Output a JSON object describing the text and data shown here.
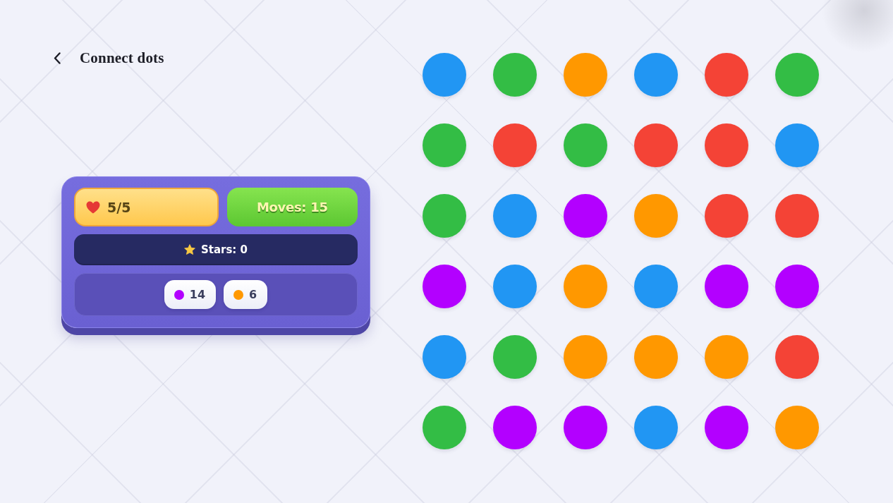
{
  "header": {
    "title": "Connect dots"
  },
  "stats": {
    "lives": "5/5",
    "moves": "Moves: 15",
    "stars": "Stars: 0",
    "goals": [
      {
        "color": "#b300ff",
        "count": "14"
      },
      {
        "color": "#ff9800",
        "count": "6"
      }
    ]
  },
  "board": {
    "rows": [
      [
        {
          "color": "#2196f3"
        },
        {
          "color": "#33bd45"
        },
        {
          "color": "#ff9800"
        },
        {
          "color": "#2196f3"
        },
        {
          "color": "#f44336"
        },
        {
          "color": "#33bd45"
        }
      ],
      [
        {
          "color": "#33bd45"
        },
        {
          "color": "#f44336"
        },
        {
          "color": "#33bd45"
        },
        {
          "color": "#f44336"
        },
        {
          "color": "#f44336"
        },
        {
          "color": "#2196f3"
        }
      ],
      [
        {
          "color": "#33bd45"
        },
        {
          "color": "#2196f3"
        },
        {
          "color": "#b300ff"
        },
        {
          "color": "#ff9800"
        },
        {
          "color": "#f44336"
        },
        {
          "color": "#f44336"
        }
      ],
      [
        {
          "color": "#b300ff"
        },
        {
          "color": "#2196f3"
        },
        {
          "color": "#ff9800"
        },
        {
          "color": "#2196f3"
        },
        {
          "color": "#b300ff"
        },
        {
          "color": "#b300ff"
        }
      ],
      [
        {
          "color": "#2196f3"
        },
        {
          "color": "#33bd45"
        },
        {
          "color": "#ff9800"
        },
        {
          "color": "#ff9800"
        },
        {
          "color": "#ff9800"
        },
        {
          "color": "#f44336"
        }
      ],
      [
        {
          "color": "#33bd45"
        },
        {
          "color": "#b300ff"
        },
        {
          "color": "#b300ff"
        },
        {
          "color": "#2196f3"
        },
        {
          "color": "#b300ff"
        },
        {
          "color": "#ff9800"
        }
      ]
    ]
  }
}
